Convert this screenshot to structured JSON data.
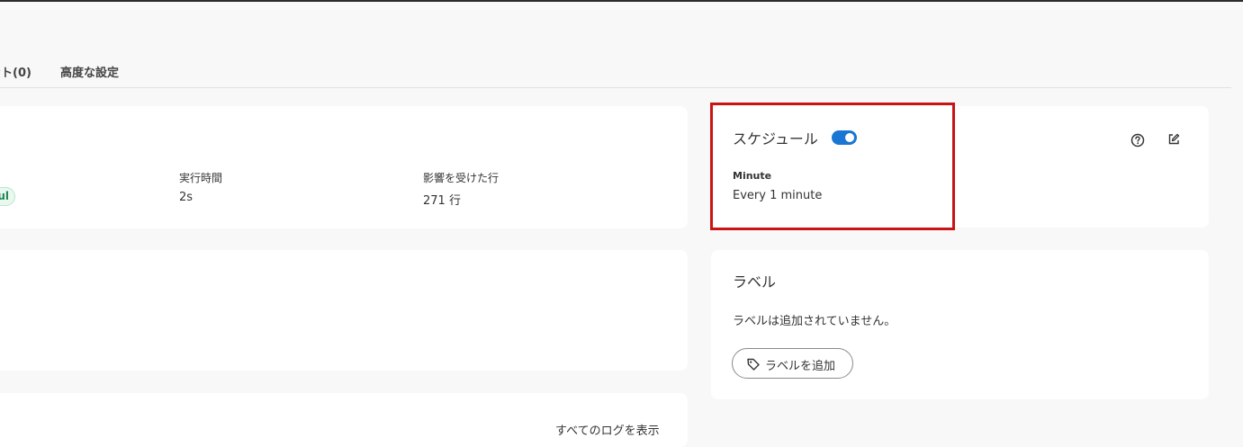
{
  "tabs": [
    {
      "label": "ント(0)"
    },
    {
      "label": "高度な設定"
    }
  ],
  "run_summary": {
    "status_label": "ul",
    "exec_time": {
      "label": "実行時間",
      "value": "2s"
    },
    "rows_affected": {
      "label": "影響を受けた行",
      "value": "271 行"
    }
  },
  "logs": {
    "view_all_label": "すべてのログを表示"
  },
  "schedule": {
    "title": "スケジュール",
    "enabled": true,
    "frequency_label": "Minute",
    "frequency_value": "Every 1 minute",
    "help_icon": "help-circle-icon",
    "edit_icon": "edit-icon"
  },
  "labels": {
    "title": "ラベル",
    "empty_text": "ラベルは追加されていません。",
    "add_button_label": "ラベルを追加",
    "add_button_icon": "tag-icon"
  },
  "colors": {
    "toggle_on": "#1976d2",
    "highlight_border": "#c81414",
    "status_success": "#1f8a55"
  }
}
